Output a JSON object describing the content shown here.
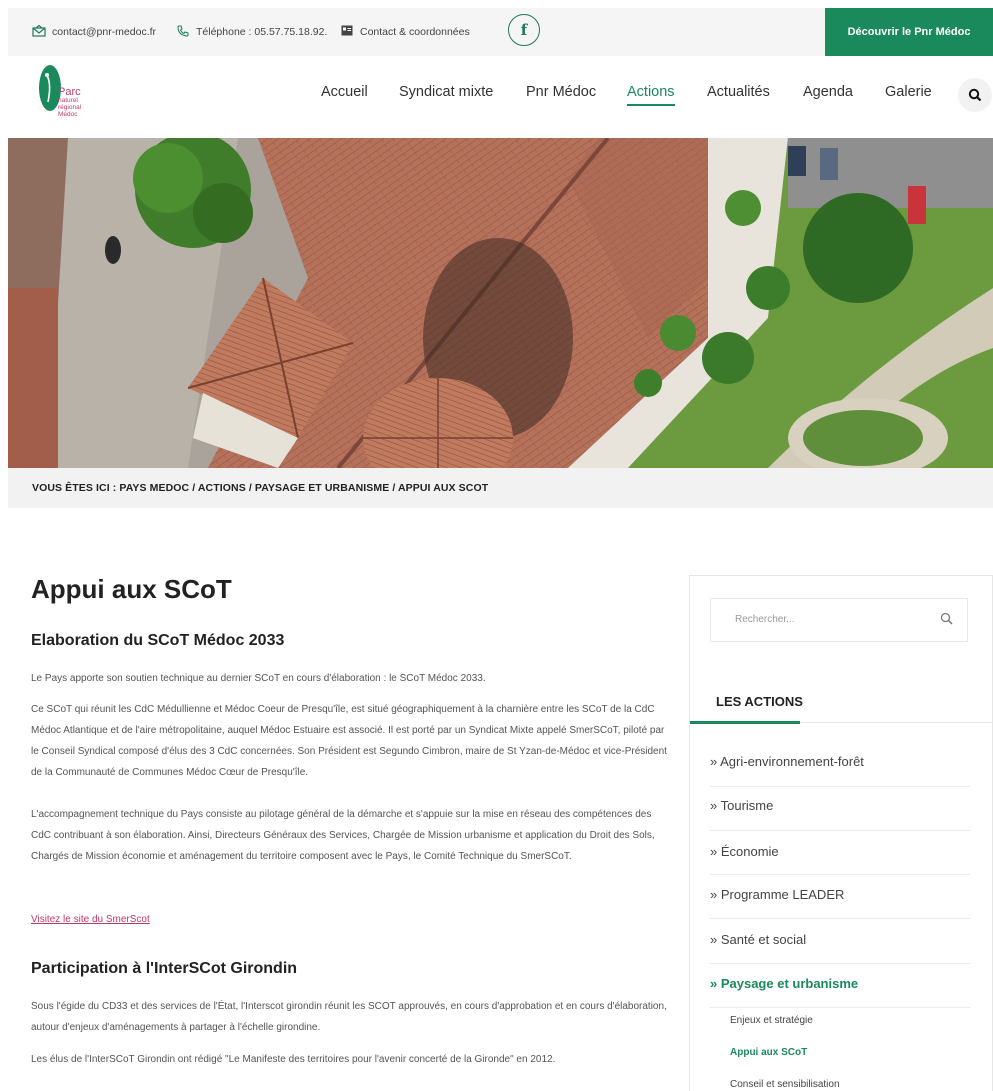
{
  "topbar": {
    "email": "contact@pnr-medoc.fr",
    "phone": "Téléphone : 05.57.75.18.92.",
    "contact": "Contact & coordonnées",
    "facebook_glyph": "f",
    "discover_label": "Découvrir le Pnr Médoc"
  },
  "header": {
    "logo_lines": [
      "Parc",
      "naturel",
      "régional",
      "Médoc"
    ],
    "nav": [
      "Accueil",
      "Syndicat mixte",
      "Pnr Médoc",
      "Actions",
      "Actualités",
      "Agenda",
      "Galerie"
    ],
    "active_nav": "Actions"
  },
  "breadcrumb": "VOUS ÊTES ICI : PAYS MEDOC / ACTIONS / PAYSAGE ET URBANISME / APPUI AUX SCOT",
  "main": {
    "title": "Appui aux SCoT",
    "section1_title": "Elaboration du SCoT Médoc 2033",
    "p1": "Le Pays apporte son soutien technique au dernier SCoT en cours d'élaboration : le SCoT Médoc 2033.",
    "p2": "Ce SCoT qui réunit les CdC Médullienne et Médoc Coeur de Presqu'île, est situé géographiquement à la charnière entre les SCoT de la CdC Médoc Atlantique et de l'aire métropolitaine, auquel Médoc Estuaire est associé. Il est porté par un Syndicat Mixte appelé SmerSCoT, piloté par le Conseil Syndical composé d'élus des 3 CdC concernées. Son Président est Segundo Cimbron, maire de St Yzan-de-Médoc et vice-Président de la Communauté de Communes Médoc Cœur de Presqu'île.",
    "p3": "L'accompagnement technique du Pays consiste au pilotage général de la démarche et s'appuie sur la mise en réseau des compétences des CdC contribuant à son élaboration. Ainsi, Directeurs Généraux des Services, Chargée de Mission urbanisme et application du Droit des Sols, Chargés de Mission économie et aménagement du territoire composent avec le Pays, le Comité Technique du SmerSCoT.",
    "link": "Visitez le site du SmerScot",
    "section2_title": "Participation à l'InterSCot Girondin",
    "p4": "Sous l'égide du CD33 et des services de l'État, l'Interscot girondin réunit les SCOT approuvés, en cours d'approbation et en cours d'élaboration, autour d'enjeux d'aménagements à partager à l'échelle girondine.",
    "p5": "Les élus de l'InterSCoT Girondin ont rédigé \"Le Manifeste des territoires pour l'avenir concerté de la Gironde\" en 2012."
  },
  "sidebar": {
    "search_placeholder": "Rechercher...",
    "title": "LES ACTIONS",
    "items": [
      "» Agri-environnement-forêt",
      "» Tourisme",
      "» Économie",
      "» Programme LEADER",
      "» Santé et social",
      "» Paysage et urbanisme"
    ],
    "subitems": [
      "Enjeux et stratégie",
      "Appui aux SCoT",
      "Conseil et sensibilisation"
    ]
  },
  "colors": {
    "brand_green": "#1a8a5c",
    "link_pink": "#c0396b",
    "topbar_bg": "#f5f5f5"
  }
}
